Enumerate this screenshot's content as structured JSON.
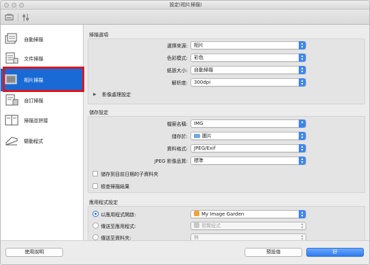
{
  "window": {
    "title": "設定(相片掃描)"
  },
  "toolbar": {
    "icons": [
      "scan-settings-icon",
      "general-settings-icon"
    ]
  },
  "sidebar": {
    "items": [
      {
        "label": "自動掃描",
        "icon": "auto-scan-icon"
      },
      {
        "label": "文件掃描",
        "icon": "document-scan-icon"
      },
      {
        "label": "相片掃描",
        "icon": "photo-scan-icon",
        "selected": true
      },
      {
        "label": "自訂掃描",
        "icon": "custom-scan-icon"
      },
      {
        "label": "掃描並拼接",
        "icon": "scan-stitch-icon"
      },
      {
        "label": "驅動程式",
        "icon": "driver-icon"
      }
    ]
  },
  "scan_options": {
    "title": "掃描選項",
    "source_label": "選擇來源:",
    "source_value": "相片",
    "color_mode_label": "色彩模式:",
    "color_mode_value": "彩色",
    "paper_size_label": "紙張大小:",
    "paper_size_value": "自動掃描",
    "resolution_label": "解析度:",
    "resolution_value": "300dpi",
    "image_processing_label": "影像處理設定"
  },
  "save_settings": {
    "title": "儲存設定",
    "file_name_label": "檔案名稱:",
    "file_name_value": "IMG",
    "save_in_label": "儲存於:",
    "save_in_value": "圖片",
    "data_format_label": "資料格式:",
    "data_format_value": "JPEG/Exif",
    "jpeg_quality_label": "JPEG 影像品質:",
    "jpeg_quality_value": "標準",
    "subfolder_label": "儲存到目前日期的子資料夾",
    "check_results_label": "檢查掃描結果"
  },
  "app_settings": {
    "title": "應用程式設定",
    "open_with_label": "以應用程式開啟:",
    "open_with_value": "My Image Garden",
    "send_to_app_label": "傳送至應用程式:",
    "send_to_app_value": "預覽程式",
    "send_to_folder_label": "傳送至資料夾:",
    "send_to_folder_value": "無"
  },
  "footer": {
    "help_button": "使用說明",
    "defaults_button": "預設值",
    "ok_button": "好"
  },
  "colors": {
    "accent": "#1a6ad6",
    "highlight_outline": "#e0141a",
    "popup_arrow": "#3d84f0"
  }
}
